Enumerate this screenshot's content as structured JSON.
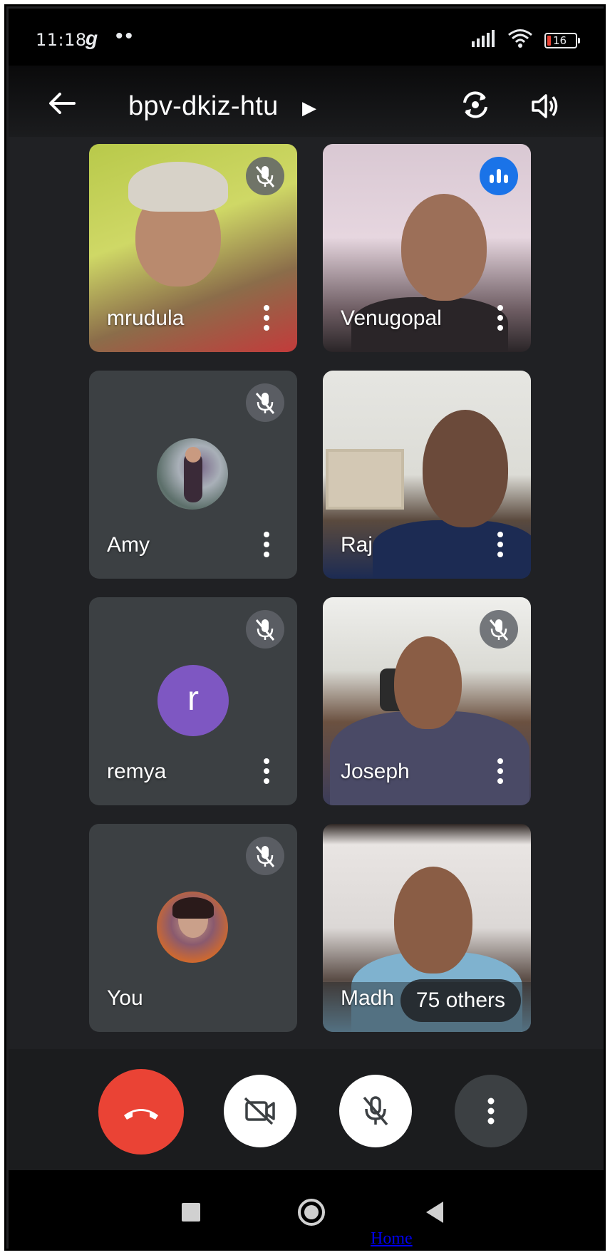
{
  "status_bar": {
    "time": "11:18",
    "app_icon": "g-icon",
    "dots": "••",
    "battery_level": "16",
    "icons": [
      "signal-icon",
      "wifi-icon",
      "battery-icon"
    ]
  },
  "header": {
    "meeting_code": "bpv-dkiz-htu",
    "icons": [
      "back-arrow-icon",
      "chevron-right-icon",
      "switch-camera-icon",
      "speaker-icon"
    ]
  },
  "participants": [
    {
      "name": "mrudula",
      "muted": true,
      "tile": "video"
    },
    {
      "name": "Venugopal",
      "speaking": true,
      "tile": "video"
    },
    {
      "name": "Amy",
      "muted": true,
      "tile": "photo-avatar"
    },
    {
      "name": "Raj",
      "tile": "video"
    },
    {
      "name": "remya",
      "muted": true,
      "tile": "letter-avatar",
      "avatar_letter": "r",
      "avatar_color": "#7e57c2"
    },
    {
      "name": "Joseph",
      "muted": true,
      "tile": "video"
    },
    {
      "name": "You",
      "muted": true,
      "tile": "photo-avatar"
    },
    {
      "name": "Madh",
      "tile": "video"
    }
  ],
  "others_label": "75 others",
  "controls": {
    "end_call_color": "#ea4335",
    "icons": [
      "end-call-icon",
      "camera-off-icon",
      "mic-off-icon",
      "more-vert-icon"
    ]
  },
  "nav_bar": {
    "icons": [
      "recents-icon",
      "home-icon",
      "back-icon"
    ]
  },
  "footer_link": "Home",
  "colors": {
    "background": "#202124",
    "tile": "#3c4043",
    "speaking_badge": "#1a73e8",
    "mute_badge": "#5f6368"
  }
}
